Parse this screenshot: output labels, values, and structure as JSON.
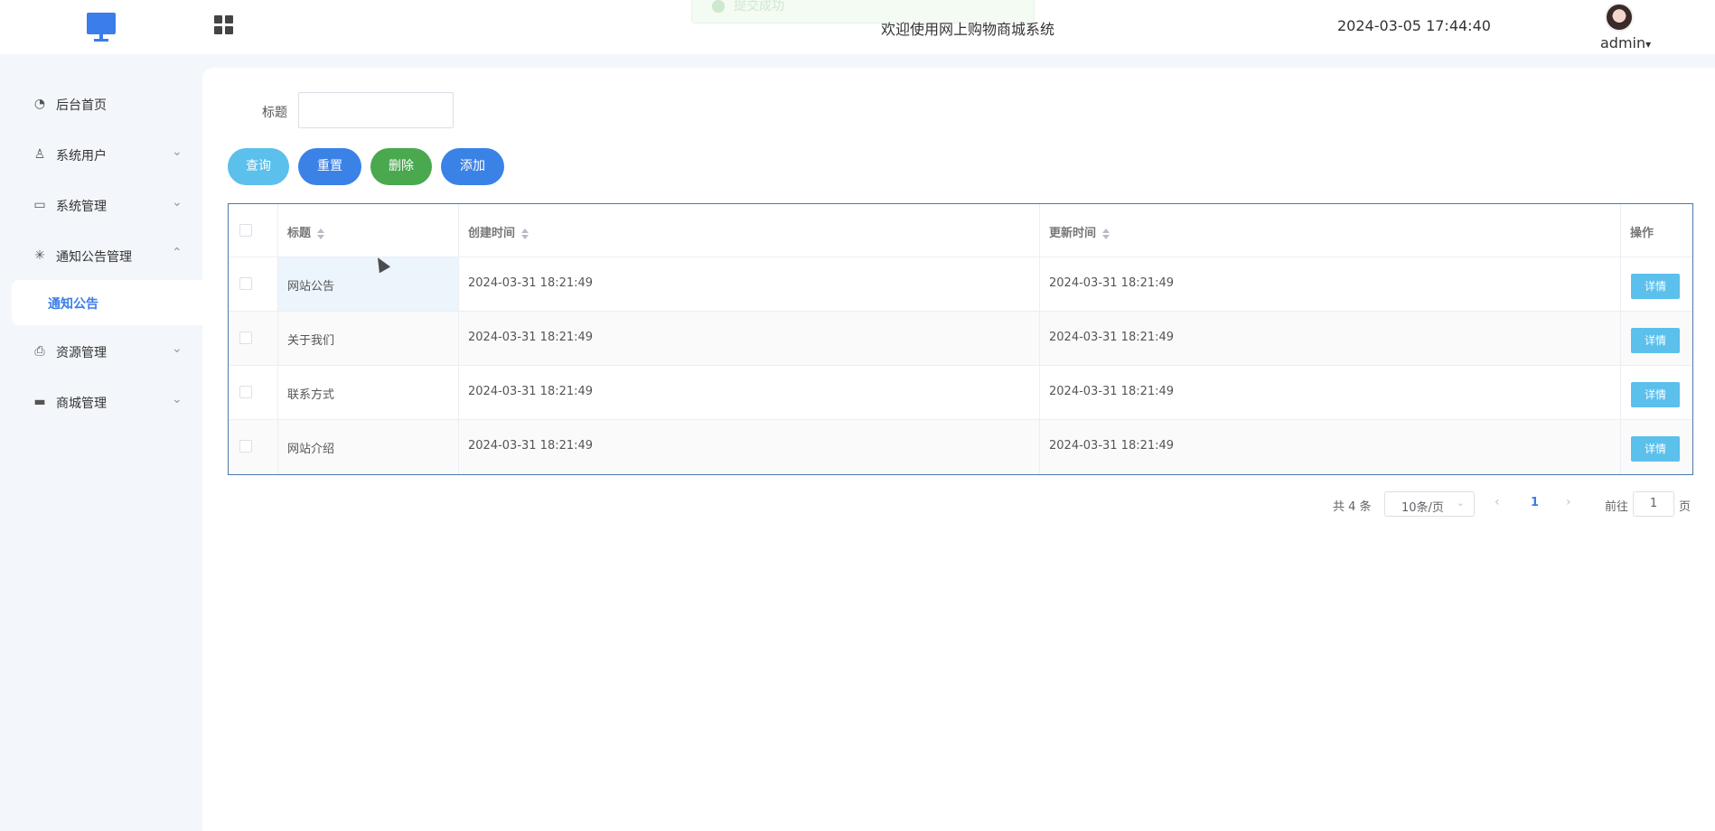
{
  "header": {
    "toast": "提交成功",
    "title": "欢迎使用网上购物商城系统",
    "datetime": "2024-03-05 17:44:40",
    "user": "admin",
    "user_arrow": "▾"
  },
  "sidebar": {
    "items": [
      {
        "label": "后台首页",
        "icon": "pie-chart-icon",
        "glyph": "◔"
      },
      {
        "label": "系统用户",
        "icon": "user-icon",
        "glyph": "♙",
        "chevron": "⌄"
      },
      {
        "label": "系统管理",
        "icon": "folder-check-icon",
        "glyph": "▭",
        "chevron": "⌄"
      },
      {
        "label": "通知公告管理",
        "icon": "loading-icon",
        "glyph": "✳",
        "chevron": "⌃"
      },
      {
        "label": "资源管理",
        "icon": "printer-icon",
        "glyph": "⎙",
        "chevron": "⌄"
      },
      {
        "label": "商城管理",
        "icon": "shop-icon",
        "glyph": "▬",
        "chevron": "⌄"
      }
    ],
    "active_sub": "通知公告"
  },
  "search": {
    "label": "标题",
    "value": ""
  },
  "actions": {
    "query": "查询",
    "reset": "重置",
    "delete": "删除",
    "add": "添加"
  },
  "table": {
    "headers": [
      "标题",
      "创建时间",
      "更新时间",
      "操作"
    ],
    "rows": [
      {
        "title": "网站公告",
        "created": "2024-03-31 18:21:49",
        "updated": "2024-03-31 18:21:49",
        "action": "详情"
      },
      {
        "title": "关于我们",
        "created": "2024-03-31 18:21:49",
        "updated": "2024-03-31 18:21:49",
        "action": "详情"
      },
      {
        "title": "联系方式",
        "created": "2024-03-31 18:21:49",
        "updated": "2024-03-31 18:21:49",
        "action": "详情"
      },
      {
        "title": "网站介绍",
        "created": "2024-03-31 18:21:49",
        "updated": "2024-03-31 18:21:49",
        "action": "详情"
      }
    ]
  },
  "pagination": {
    "total": "共 4 条",
    "page_size": "10条/页",
    "size_arrow": "⌄",
    "prev": "‹",
    "current": "1",
    "next": "›",
    "goto_label": "前往",
    "goto_value": "1",
    "page_suffix": "页"
  },
  "colors": {
    "accent": "#3b82e6",
    "info": "#5bc0eb",
    "danger_green": "#4aa84f"
  }
}
